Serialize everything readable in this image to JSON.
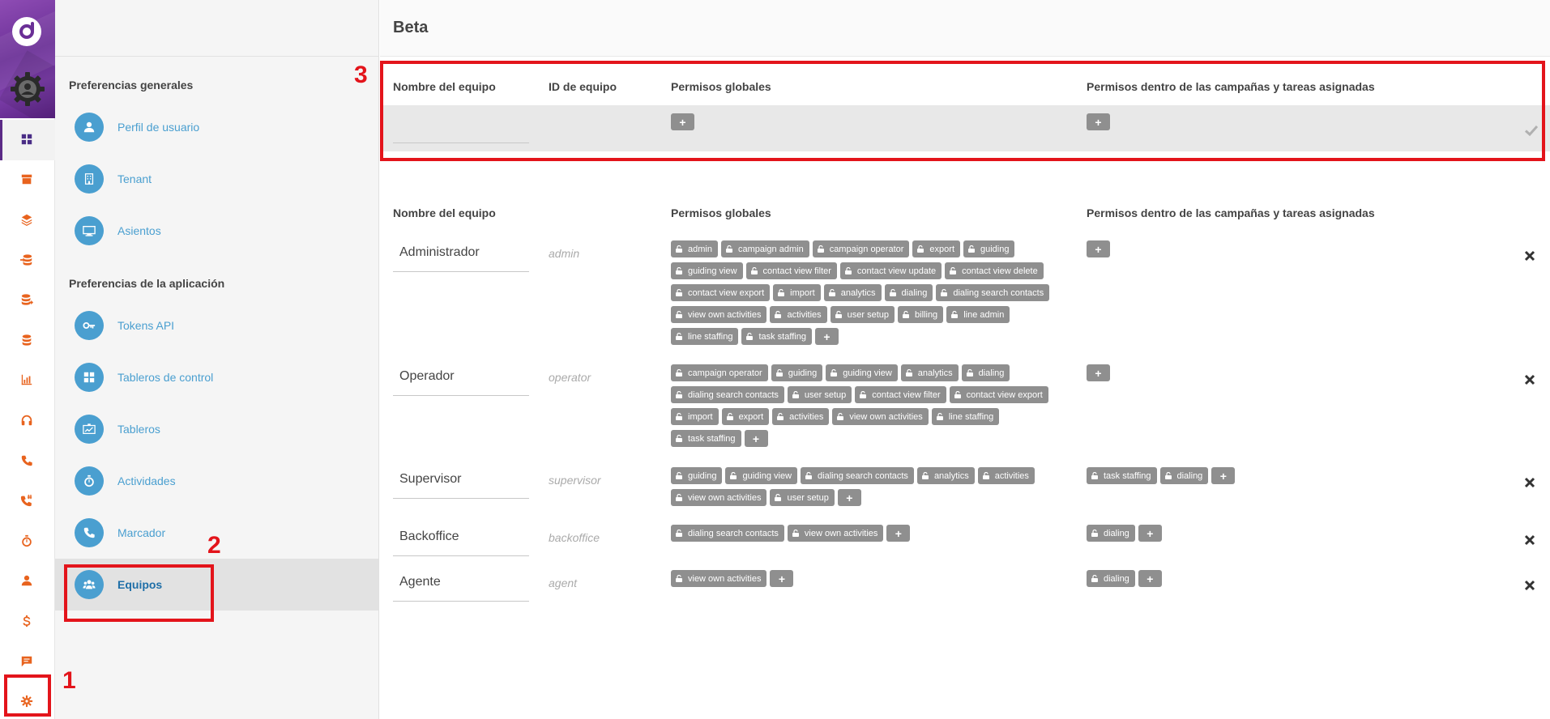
{
  "rail": {
    "items": [
      {
        "icon": "dashboard-icon",
        "active": true
      },
      {
        "icon": "archive-icon"
      },
      {
        "icon": "layers-icon"
      },
      {
        "icon": "database-import-icon"
      },
      {
        "icon": "database-export-icon"
      },
      {
        "icon": "database-icon"
      },
      {
        "icon": "bar-chart-icon"
      },
      {
        "icon": "headset-icon"
      },
      {
        "icon": "phone-icon"
      },
      {
        "icon": "phone-hash-icon"
      },
      {
        "icon": "stopwatch-icon"
      },
      {
        "icon": "user-icon"
      },
      {
        "icon": "dollar-icon"
      },
      {
        "icon": "chat-icon"
      },
      {
        "icon": "gear-icon"
      }
    ]
  },
  "settings": {
    "general_title": "Preferencias generales",
    "general_items": [
      {
        "label": "Perfil de usuario",
        "icon": "user-icon"
      },
      {
        "label": "Tenant",
        "icon": "building-icon"
      },
      {
        "label": "Asientos",
        "icon": "monitor-icon"
      }
    ],
    "app_title": "Preferencias de la aplicación",
    "app_items": [
      {
        "label": "Tokens API",
        "icon": "key-icon"
      },
      {
        "label": "Tableros de control",
        "icon": "dashboard-icon"
      },
      {
        "label": "Tableros",
        "icon": "chart-board-icon"
      },
      {
        "label": "Actividades",
        "icon": "stopwatch-icon"
      },
      {
        "label": "Marcador",
        "icon": "phone-icon"
      },
      {
        "label": "Equipos",
        "icon": "team-icon",
        "active": true
      }
    ]
  },
  "main": {
    "title": "Beta",
    "new_headers": {
      "name": "Nombre del equipo",
      "id": "ID de equipo",
      "global": "Permisos globales",
      "campaign": "Permisos dentro de las campañas y tareas asignadas"
    },
    "list_headers": {
      "name": "Nombre del equipo",
      "global": "Permisos globales",
      "campaign": "Permisos dentro de las campañas y tareas asignadas"
    },
    "add_symbol": "+",
    "teams": [
      {
        "name": "Administrador",
        "id": "admin",
        "global": [
          "admin",
          "campaign admin",
          "campaign operator",
          "export",
          "guiding",
          "guiding view",
          "contact view filter",
          "contact view update",
          "contact view delete",
          "contact view export",
          "import",
          "analytics",
          "dialing",
          "dialing search contacts",
          "view own activities",
          "activities",
          "user setup",
          "billing",
          "line admin",
          "line staffing",
          "task staffing"
        ],
        "campaign": []
      },
      {
        "name": "Operador",
        "id": "operator",
        "global": [
          "campaign operator",
          "guiding",
          "guiding view",
          "analytics",
          "dialing",
          "dialing search contacts",
          "user setup",
          "contact view filter",
          "contact view export",
          "import",
          "export",
          "activities",
          "view own activities",
          "line staffing",
          "task staffing"
        ],
        "campaign": []
      },
      {
        "name": "Supervisor",
        "id": "supervisor",
        "global": [
          "guiding",
          "guiding view",
          "dialing search contacts",
          "analytics",
          "activities",
          "view own activities",
          "user setup"
        ],
        "campaign": [
          "task staffing",
          "dialing"
        ]
      },
      {
        "name": "Backoffice",
        "id": "backoffice",
        "global": [
          "dialing search contacts",
          "view own activities"
        ],
        "campaign": [
          "dialing"
        ]
      },
      {
        "name": "Agente",
        "id": "agent",
        "global": [
          "view own activities"
        ],
        "campaign": [
          "dialing"
        ]
      }
    ]
  },
  "annotations": [
    "1",
    "2",
    "3"
  ],
  "colors": {
    "accent": "#4a9fd0",
    "rail_icon": "#e8631e",
    "brand_purple": "#6a2f96",
    "annotation_red": "#e3141b",
    "tag_gray": "#8f8f8f"
  }
}
